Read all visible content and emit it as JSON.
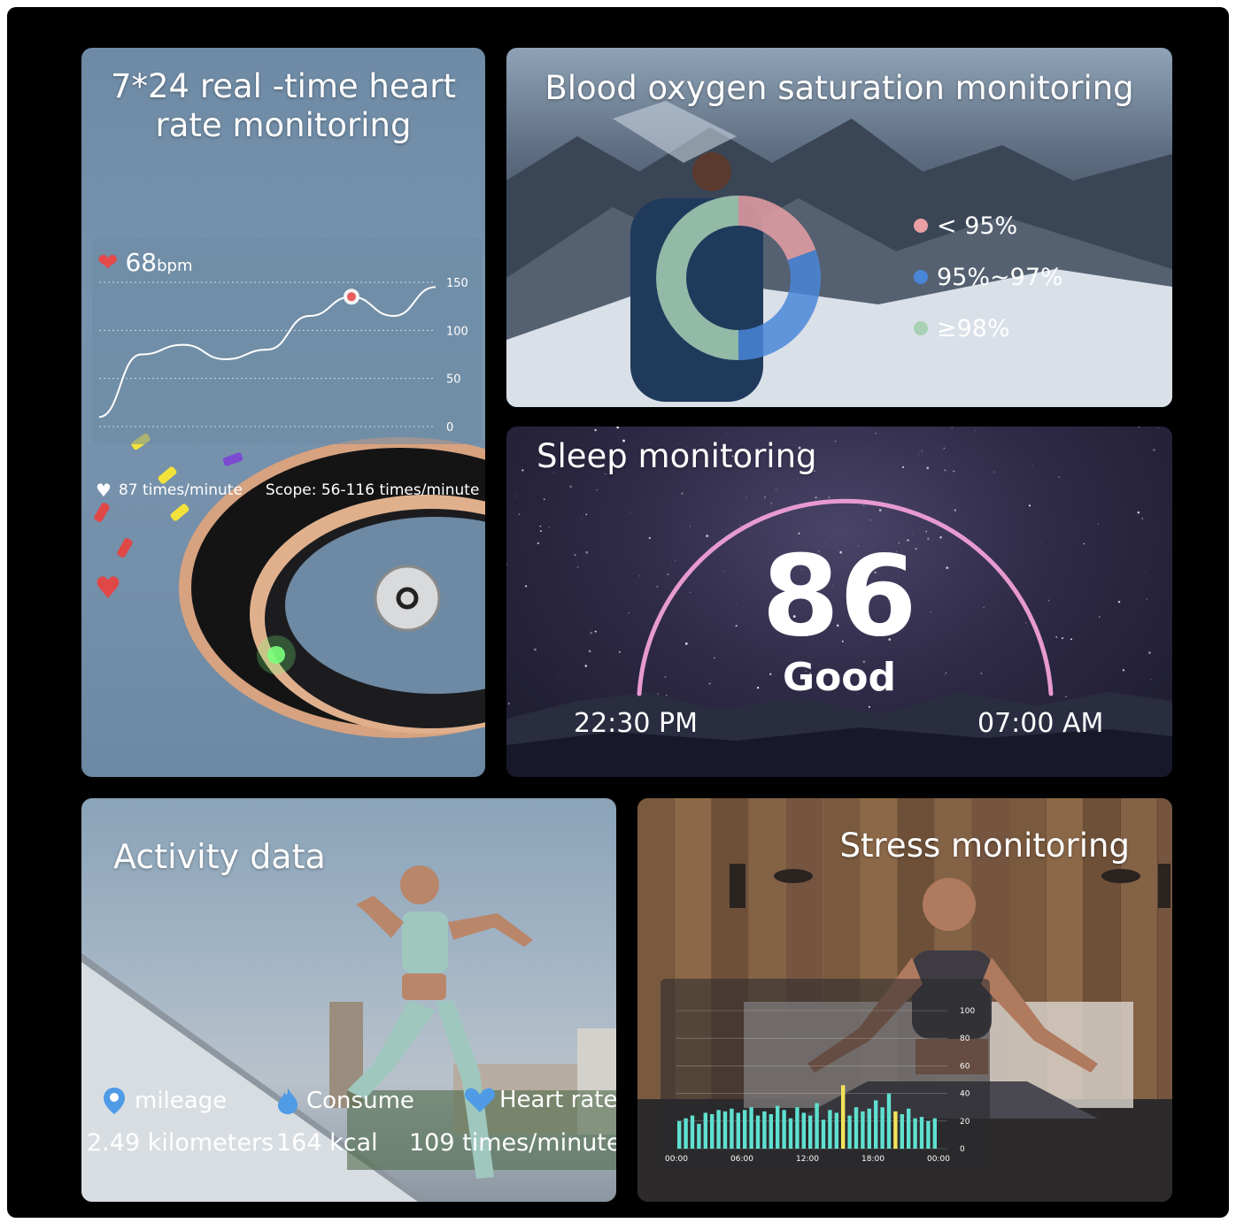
{
  "heart": {
    "title_line1": "7*24 real -time heart",
    "title_line2": "rate monitoring",
    "bpm_value": "68",
    "bpm_unit": "bpm",
    "axis_ticks": [
      "150",
      "100",
      "50",
      "0"
    ],
    "current_text": "87 times/minute",
    "scope_text": "Scope: 56-116 times/minute"
  },
  "oxygen": {
    "title": "Blood oxygen saturation monitoring",
    "legend": [
      {
        "label": "< 95%",
        "color": "#e8a0a4"
      },
      {
        "label": "95%~97%",
        "color": "#4a86d8"
      },
      {
        "label": "≥98%",
        "color": "#a8d0b4"
      }
    ]
  },
  "sleep": {
    "title": "Sleep monitoring",
    "score": "86",
    "rating": "Good",
    "start_time": "22:30 PM",
    "end_time": "07:00 AM"
  },
  "activity": {
    "title": "Activity data",
    "stats": [
      {
        "label": "mileage",
        "value": "2.49 kilometers",
        "icon": "location-pin-icon"
      },
      {
        "label": "Consume",
        "value": "164 kcal",
        "icon": "flame-icon"
      },
      {
        "label": "Heart rate",
        "value": "109 times/minute",
        "icon": "heart-icon"
      }
    ]
  },
  "stress": {
    "title": "Stress monitoring",
    "y_ticks": [
      "100",
      "80",
      "60",
      "40",
      "20",
      "0"
    ],
    "x_ticks": [
      "00:00",
      "06:00",
      "12:00",
      "18:00",
      "00:00"
    ]
  },
  "colors": {
    "oxy_low": "#e8a0a4",
    "oxy_mid": "#4a86d8",
    "oxy_high": "#a8d0b4",
    "sleep_arc": "#e79ad0",
    "stress_bar": "#5fe0d0",
    "stress_peak": "#f2e35a"
  },
  "chart_data": [
    {
      "type": "line",
      "ylim": [
        0,
        150
      ],
      "y_ticks": [
        0,
        50,
        100,
        150
      ],
      "series": [
        {
          "values": [
            10,
            75,
            85,
            70,
            80,
            115,
            135,
            115,
            145
          ]
        }
      ]
    },
    {
      "type": "bar",
      "x_ticks": [
        "00:00",
        "06:00",
        "12:00",
        "18:00",
        "00:00"
      ],
      "ylim": [
        0,
        100
      ],
      "values": [
        20,
        22,
        24,
        18,
        26,
        25,
        28,
        27,
        29,
        26,
        28,
        30,
        24,
        27,
        25,
        31,
        28,
        22,
        30,
        26,
        24,
        33,
        21,
        28,
        26,
        46,
        24,
        30,
        27,
        29,
        35,
        30,
        40,
        27,
        25,
        29,
        22,
        23,
        20,
        22
      ]
    }
  ]
}
